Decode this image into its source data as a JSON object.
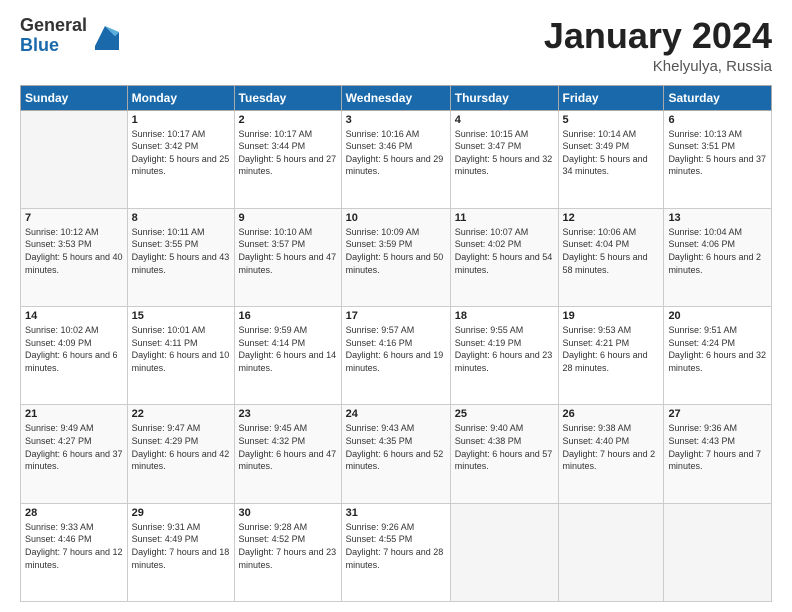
{
  "logo": {
    "general": "General",
    "blue": "Blue"
  },
  "title": "January 2024",
  "location": "Khelyulya, Russia",
  "days_header": [
    "Sunday",
    "Monday",
    "Tuesday",
    "Wednesday",
    "Thursday",
    "Friday",
    "Saturday"
  ],
  "weeks": [
    [
      {
        "day": "",
        "sunrise": "",
        "sunset": "",
        "daylight": ""
      },
      {
        "day": "1",
        "sunrise": "Sunrise: 10:17 AM",
        "sunset": "Sunset: 3:42 PM",
        "daylight": "Daylight: 5 hours and 25 minutes."
      },
      {
        "day": "2",
        "sunrise": "Sunrise: 10:17 AM",
        "sunset": "Sunset: 3:44 PM",
        "daylight": "Daylight: 5 hours and 27 minutes."
      },
      {
        "day": "3",
        "sunrise": "Sunrise: 10:16 AM",
        "sunset": "Sunset: 3:46 PM",
        "daylight": "Daylight: 5 hours and 29 minutes."
      },
      {
        "day": "4",
        "sunrise": "Sunrise: 10:15 AM",
        "sunset": "Sunset: 3:47 PM",
        "daylight": "Daylight: 5 hours and 32 minutes."
      },
      {
        "day": "5",
        "sunrise": "Sunrise: 10:14 AM",
        "sunset": "Sunset: 3:49 PM",
        "daylight": "Daylight: 5 hours and 34 minutes."
      },
      {
        "day": "6",
        "sunrise": "Sunrise: 10:13 AM",
        "sunset": "Sunset: 3:51 PM",
        "daylight": "Daylight: 5 hours and 37 minutes."
      }
    ],
    [
      {
        "day": "7",
        "sunrise": "Sunrise: 10:12 AM",
        "sunset": "Sunset: 3:53 PM",
        "daylight": "Daylight: 5 hours and 40 minutes."
      },
      {
        "day": "8",
        "sunrise": "Sunrise: 10:11 AM",
        "sunset": "Sunset: 3:55 PM",
        "daylight": "Daylight: 5 hours and 43 minutes."
      },
      {
        "day": "9",
        "sunrise": "Sunrise: 10:10 AM",
        "sunset": "Sunset: 3:57 PM",
        "daylight": "Daylight: 5 hours and 47 minutes."
      },
      {
        "day": "10",
        "sunrise": "Sunrise: 10:09 AM",
        "sunset": "Sunset: 3:59 PM",
        "daylight": "Daylight: 5 hours and 50 minutes."
      },
      {
        "day": "11",
        "sunrise": "Sunrise: 10:07 AM",
        "sunset": "Sunset: 4:02 PM",
        "daylight": "Daylight: 5 hours and 54 minutes."
      },
      {
        "day": "12",
        "sunrise": "Sunrise: 10:06 AM",
        "sunset": "Sunset: 4:04 PM",
        "daylight": "Daylight: 5 hours and 58 minutes."
      },
      {
        "day": "13",
        "sunrise": "Sunrise: 10:04 AM",
        "sunset": "Sunset: 4:06 PM",
        "daylight": "Daylight: 6 hours and 2 minutes."
      }
    ],
    [
      {
        "day": "14",
        "sunrise": "Sunrise: 10:02 AM",
        "sunset": "Sunset: 4:09 PM",
        "daylight": "Daylight: 6 hours and 6 minutes."
      },
      {
        "day": "15",
        "sunrise": "Sunrise: 10:01 AM",
        "sunset": "Sunset: 4:11 PM",
        "daylight": "Daylight: 6 hours and 10 minutes."
      },
      {
        "day": "16",
        "sunrise": "Sunrise: 9:59 AM",
        "sunset": "Sunset: 4:14 PM",
        "daylight": "Daylight: 6 hours and 14 minutes."
      },
      {
        "day": "17",
        "sunrise": "Sunrise: 9:57 AM",
        "sunset": "Sunset: 4:16 PM",
        "daylight": "Daylight: 6 hours and 19 minutes."
      },
      {
        "day": "18",
        "sunrise": "Sunrise: 9:55 AM",
        "sunset": "Sunset: 4:19 PM",
        "daylight": "Daylight: 6 hours and 23 minutes."
      },
      {
        "day": "19",
        "sunrise": "Sunrise: 9:53 AM",
        "sunset": "Sunset: 4:21 PM",
        "daylight": "Daylight: 6 hours and 28 minutes."
      },
      {
        "day": "20",
        "sunrise": "Sunrise: 9:51 AM",
        "sunset": "Sunset: 4:24 PM",
        "daylight": "Daylight: 6 hours and 32 minutes."
      }
    ],
    [
      {
        "day": "21",
        "sunrise": "Sunrise: 9:49 AM",
        "sunset": "Sunset: 4:27 PM",
        "daylight": "Daylight: 6 hours and 37 minutes."
      },
      {
        "day": "22",
        "sunrise": "Sunrise: 9:47 AM",
        "sunset": "Sunset: 4:29 PM",
        "daylight": "Daylight: 6 hours and 42 minutes."
      },
      {
        "day": "23",
        "sunrise": "Sunrise: 9:45 AM",
        "sunset": "Sunset: 4:32 PM",
        "daylight": "Daylight: 6 hours and 47 minutes."
      },
      {
        "day": "24",
        "sunrise": "Sunrise: 9:43 AM",
        "sunset": "Sunset: 4:35 PM",
        "daylight": "Daylight: 6 hours and 52 minutes."
      },
      {
        "day": "25",
        "sunrise": "Sunrise: 9:40 AM",
        "sunset": "Sunset: 4:38 PM",
        "daylight": "Daylight: 6 hours and 57 minutes."
      },
      {
        "day": "26",
        "sunrise": "Sunrise: 9:38 AM",
        "sunset": "Sunset: 4:40 PM",
        "daylight": "Daylight: 7 hours and 2 minutes."
      },
      {
        "day": "27",
        "sunrise": "Sunrise: 9:36 AM",
        "sunset": "Sunset: 4:43 PM",
        "daylight": "Daylight: 7 hours and 7 minutes."
      }
    ],
    [
      {
        "day": "28",
        "sunrise": "Sunrise: 9:33 AM",
        "sunset": "Sunset: 4:46 PM",
        "daylight": "Daylight: 7 hours and 12 minutes."
      },
      {
        "day": "29",
        "sunrise": "Sunrise: 9:31 AM",
        "sunset": "Sunset: 4:49 PM",
        "daylight": "Daylight: 7 hours and 18 minutes."
      },
      {
        "day": "30",
        "sunrise": "Sunrise: 9:28 AM",
        "sunset": "Sunset: 4:52 PM",
        "daylight": "Daylight: 7 hours and 23 minutes."
      },
      {
        "day": "31",
        "sunrise": "Sunrise: 9:26 AM",
        "sunset": "Sunset: 4:55 PM",
        "daylight": "Daylight: 7 hours and 28 minutes."
      },
      {
        "day": "",
        "sunrise": "",
        "sunset": "",
        "daylight": ""
      },
      {
        "day": "",
        "sunrise": "",
        "sunset": "",
        "daylight": ""
      },
      {
        "day": "",
        "sunrise": "",
        "sunset": "",
        "daylight": ""
      }
    ]
  ]
}
